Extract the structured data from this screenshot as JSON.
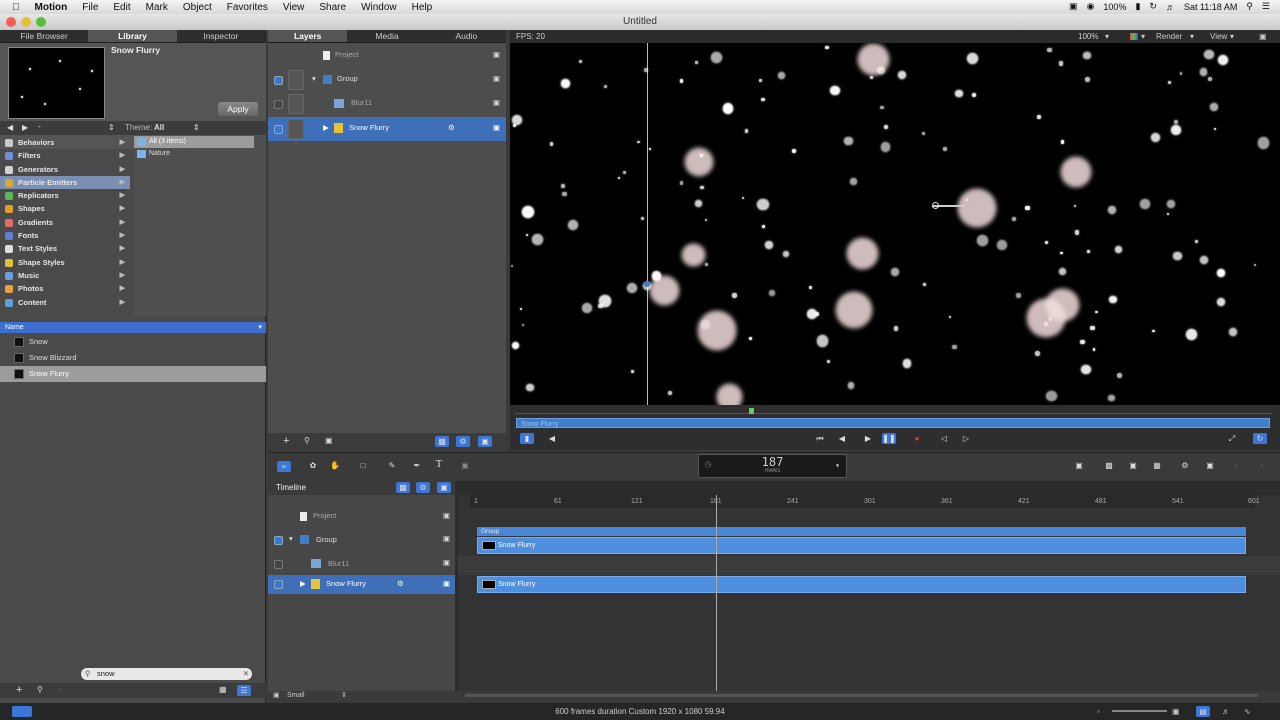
{
  "menubar": {
    "apple": "",
    "app": "Motion",
    "items": [
      "File",
      "Edit",
      "Mark",
      "Object",
      "Favorites",
      "View",
      "Share",
      "Window",
      "Help"
    ],
    "battery": "100%",
    "clock": "Sat 11:18 AM"
  },
  "window": {
    "title": "Untitled"
  },
  "left_panel": {
    "tabs": [
      "File Browser",
      "Library",
      "Inspector"
    ],
    "preview_title": "Snow Flurry",
    "apply_label": "Apply",
    "theme_label": "Theme:",
    "theme_value": "All",
    "categories": [
      {
        "label": "Behaviors",
        "color": "#c9c9c9"
      },
      {
        "label": "Filters",
        "color": "#6f8fd6"
      },
      {
        "label": "Generators",
        "color": "#d1d1d1"
      },
      {
        "label": "Particle Emitters",
        "color": "#d9a83b"
      },
      {
        "label": "Replicators",
        "color": "#5cb85c"
      },
      {
        "label": "Shapes",
        "color": "#e0a020"
      },
      {
        "label": "Gradients",
        "color": "#e06c6c"
      },
      {
        "label": "Fonts",
        "color": "#5f7fd0"
      },
      {
        "label": "Text Styles",
        "color": "#dddddd"
      },
      {
        "label": "Shape Styles",
        "color": "#e2c23a"
      },
      {
        "label": "Music",
        "color": "#6aa0e0"
      },
      {
        "label": "Photos",
        "color": "#e6a040"
      },
      {
        "label": "Content",
        "color": "#5f9fd8"
      }
    ],
    "selected_category": "Particle Emitters",
    "subfolders": [
      "All (3 items)",
      "Nature"
    ],
    "list_header": "Name",
    "items": [
      "Snow",
      "Snow Blizzard",
      "Snow Flurry"
    ],
    "selected_item": "Snow Flurry",
    "search_value": "snow"
  },
  "layers_panel": {
    "tabs": [
      "Layers",
      "Media",
      "Audio"
    ],
    "project_label": "Project",
    "layers": [
      {
        "label": "Group"
      },
      {
        "label": "Blur11"
      },
      {
        "label": "Snow Flurry"
      }
    ]
  },
  "canvas": {
    "fps": "FPS: 20",
    "zoom": "100%",
    "render_label": "Render",
    "view_label": "View",
    "mini_timeline_label": "Snow Flurry"
  },
  "toolbar": {
    "frame_number": "187",
    "frame_unit": "FRAMES"
  },
  "timeline": {
    "title": "Timeline",
    "project_label": "Project",
    "tracks": [
      {
        "label": "Group"
      },
      {
        "label": "Blur11"
      },
      {
        "label": "Snow Flurry"
      }
    ],
    "ruler_ticks": [
      "1",
      "61",
      "121",
      "181",
      "241",
      "301",
      "361",
      "421",
      "481",
      "541",
      "601"
    ],
    "group_bar_label": "Group",
    "bar_labels": [
      "Snow Flurry",
      "Snow Flurry"
    ],
    "size_label": "Small"
  },
  "status_bar": {
    "text": "600 frames duration Custom 1920 x 1080 59.94"
  }
}
